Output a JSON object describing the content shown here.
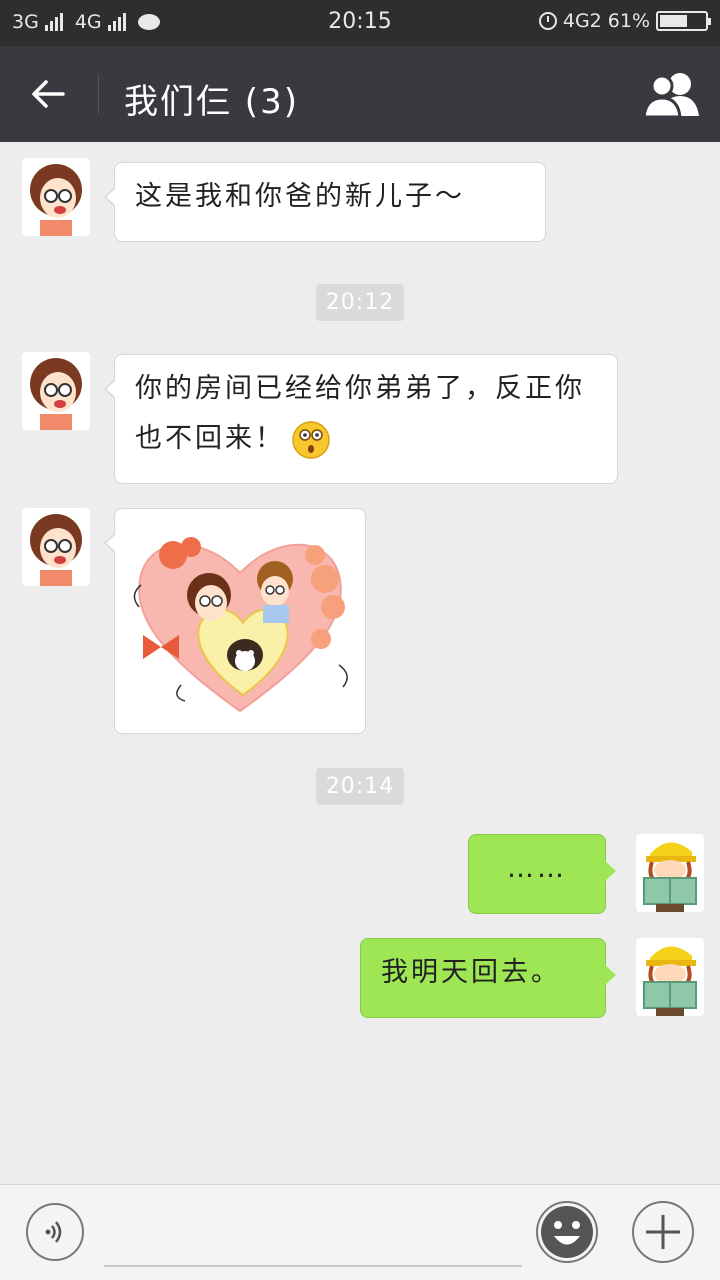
{
  "status_bar": {
    "net1": "3G",
    "net2": "4G",
    "time": "20:15",
    "net3": "4G2",
    "battery": "61%",
    "battery_level": 0.61
  },
  "header": {
    "title": "我们仨 (3)",
    "back_icon": "back-arrow-icon",
    "members_icon": "group-members-icon"
  },
  "messages": [
    {
      "side": "left",
      "text": "这是我和你爸的新儿子～"
    },
    {
      "timestamp": "20:12"
    },
    {
      "side": "left",
      "text": "你的房间已经给你弟弟了，反正你也不回来！",
      "emoji": "shocked-face-emoji"
    },
    {
      "side": "left",
      "sticker": "family-heart-sticker"
    },
    {
      "timestamp": "20:14"
    },
    {
      "side": "right",
      "text": "……"
    },
    {
      "side": "right",
      "text": "我明天回去。"
    }
  ],
  "input_bar": {
    "voice_icon": "voice-input-icon",
    "emoji_icon": "emoji-icon",
    "plus_icon": "plus-icon",
    "placeholder": ""
  },
  "colors": {
    "title_bar": "#393a3f",
    "sent_bubble": "#9ee654",
    "received_bubble": "#ffffff",
    "chat_bg": "#ededed"
  }
}
